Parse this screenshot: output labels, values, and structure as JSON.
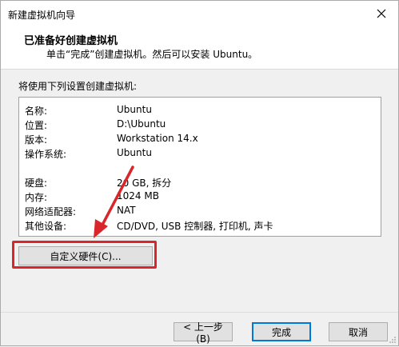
{
  "window": {
    "title": "新建虚拟机向导"
  },
  "header": {
    "title": "已准备好创建虚拟机",
    "subtitle": "单击“完成”创建虚拟机。然后可以安装 Ubuntu。"
  },
  "intro": "将使用下列设置创建虚拟机:",
  "settings": [
    {
      "key": "名称:",
      "value": "Ubuntu"
    },
    {
      "key": "位置:",
      "value": "D:\\Ubuntu"
    },
    {
      "key": "版本:",
      "value": "Workstation 14.x"
    },
    {
      "key": "操作系统:",
      "value": "Ubuntu"
    },
    {
      "key": "硬盘:",
      "value": "20 GB, 拆分"
    },
    {
      "key": "内存:",
      "value": "1024 MB"
    },
    {
      "key": "网络适配器:",
      "value": "NAT"
    },
    {
      "key": "其他设备:",
      "value": "CD/DVD, USB 控制器, 打印机, 声卡"
    }
  ],
  "buttons": {
    "customize": "自定义硬件(C)...",
    "back": "< 上一步(B)",
    "finish": "完成",
    "cancel": "取消"
  },
  "colors": {
    "highlight": "#d9262b",
    "default_button_border": "#0078d7"
  },
  "icons": {
    "close": "close-icon",
    "annotation": "red-arrow-icon"
  }
}
